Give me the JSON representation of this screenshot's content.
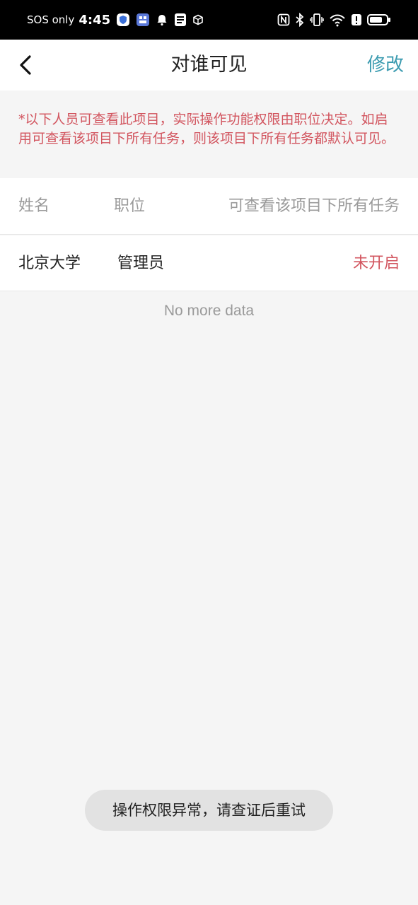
{
  "status_bar": {
    "carrier": "SOS only",
    "time": "4:45",
    "left_icons": [
      "shield-icon",
      "sim-card-icon",
      "bell-icon",
      "app-icon",
      "cube-icon"
    ],
    "right_icons": [
      "nfc-icon",
      "bluetooth-icon",
      "vibrate-icon",
      "wifi-icon",
      "alert-icon",
      "battery-icon"
    ]
  },
  "nav": {
    "back_icon": "chevron-left-icon",
    "title": "对谁可见",
    "edit_label": "修改",
    "edit_color": "#3b9bb0"
  },
  "notice": {
    "text": "*以下人员可查看此项目，实际操作功能权限由职位决定。如启用可查看该项目下所有任务，则该项目下所有任务都默认可见。",
    "color": "#d2555f"
  },
  "table": {
    "headers": {
      "name": "姓名",
      "position": "职位",
      "visible_all_tasks": "可查看该项目下所有任务"
    },
    "rows": [
      {
        "name": "北京大学",
        "position": "管理员",
        "status": "未开启"
      }
    ]
  },
  "list_footer": "No more data",
  "toast": "操作权限异常，请查证后重试"
}
